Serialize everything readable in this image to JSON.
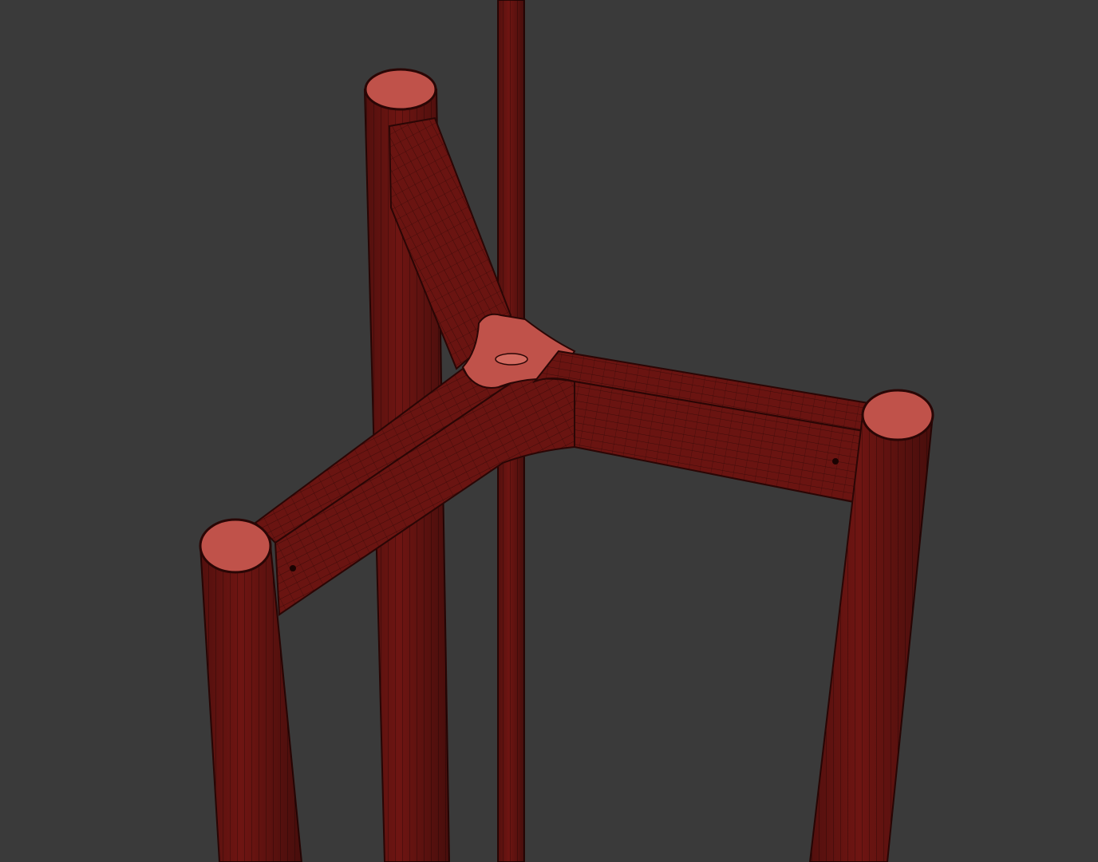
{
  "scene": {
    "background_color": "#3a3a3a",
    "mesh_color": "#6e1512",
    "mesh_shade_color": "#5a100e",
    "cap_color": "#c0524a",
    "wire_color": "#2a0605",
    "objects": [
      {
        "name": "center-rod"
      },
      {
        "name": "back-leg"
      },
      {
        "name": "left-leg"
      },
      {
        "name": "right-leg"
      },
      {
        "name": "y-brace"
      }
    ]
  }
}
